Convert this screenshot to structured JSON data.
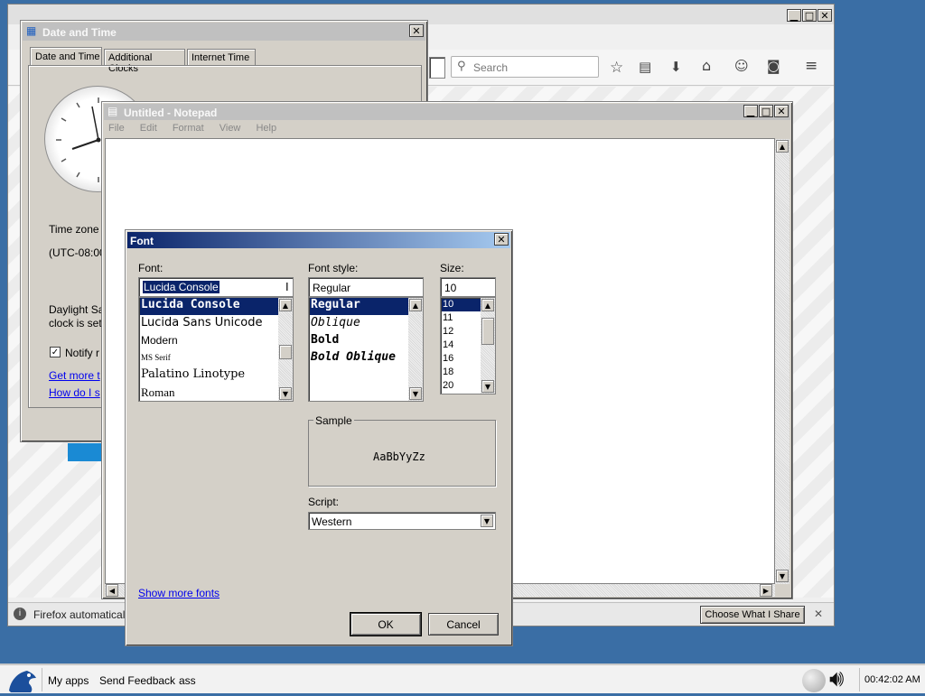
{
  "firefox": {
    "search_placeholder": "Search",
    "notification_text": "Firefox automatically",
    "choose_button": "Choose What I Share"
  },
  "datetime": {
    "title": "Date and Time",
    "tabs": [
      "Date and Time",
      "Additional Clocks",
      "Internet Time"
    ],
    "timezone_label": "Time zone",
    "timezone_value": "(UTC-08:00",
    "daylight_line1": "Daylight Sa",
    "daylight_line2": "clock is set",
    "notify_label": "Notify r",
    "link1": "Get more t",
    "link2": "How do I s"
  },
  "notepad": {
    "title": "Untitled - Notepad",
    "menu": [
      "File",
      "Edit",
      "Format",
      "View",
      "Help"
    ]
  },
  "font_dialog": {
    "title": "Font",
    "font_label": "Font:",
    "font_value": "Lucida Console",
    "font_list": [
      "Lucida Console",
      "Lucida Sans Unicode",
      "Modern",
      "MS Serif",
      "Palatino Linotype",
      "Roman"
    ],
    "style_label": "Font style:",
    "style_value": "Regular",
    "style_list": [
      "Regular",
      "Oblique",
      "Bold",
      "Bold Oblique"
    ],
    "size_label": "Size:",
    "size_value": "10",
    "size_list": [
      "10",
      "11",
      "12",
      "14",
      "16",
      "18",
      "20"
    ],
    "sample_label": "Sample",
    "sample_text": "AaBbYyZz",
    "script_label": "Script:",
    "script_value": "Western",
    "show_more": "Show more fonts",
    "ok": "OK",
    "cancel": "Cancel"
  },
  "taskbar": {
    "items": [
      "My apps",
      "Send Feedback",
      "ass"
    ],
    "clock": "00:42:02 AM"
  },
  "colors": {
    "desktop": "#3a6ea5",
    "selection": "#0a246a",
    "link": "#0000ee"
  }
}
